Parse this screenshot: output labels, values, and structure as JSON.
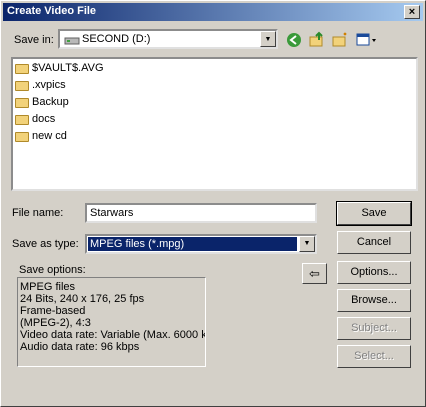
{
  "window": {
    "title": "Create Video File",
    "close_symbol": "×"
  },
  "save_in": {
    "label": "Save in:",
    "value": "SECOND (D:)"
  },
  "files": [
    {
      "name": "$VAULT$.AVG"
    },
    {
      "name": ".xvpics"
    },
    {
      "name": "Backup"
    },
    {
      "name": "docs"
    },
    {
      "name": "new cd"
    }
  ],
  "file_name": {
    "label": "File name:",
    "value": "Starwars"
  },
  "save_as_type": {
    "label": "Save as type:",
    "value": "MPEG files (*.mpg)"
  },
  "save_options": {
    "label": "Save options:",
    "lines": [
      "MPEG files",
      "24 Bits, 240 x 176, 25 fps",
      "Frame-based",
      "(MPEG-2),  4:3",
      "Video data rate: Variable (Max.  6000 k",
      "Audio data rate: 96 kbps"
    ]
  },
  "buttons": {
    "save": "Save",
    "cancel": "Cancel",
    "options": "Options...",
    "browse": "Browse...",
    "subject": "Subject...",
    "select": "Select..."
  },
  "arrow_glyph": "⇦",
  "colors": {
    "titlebar": "#0a246a",
    "selection": "#0a246a",
    "folder": "#f2d27a"
  }
}
